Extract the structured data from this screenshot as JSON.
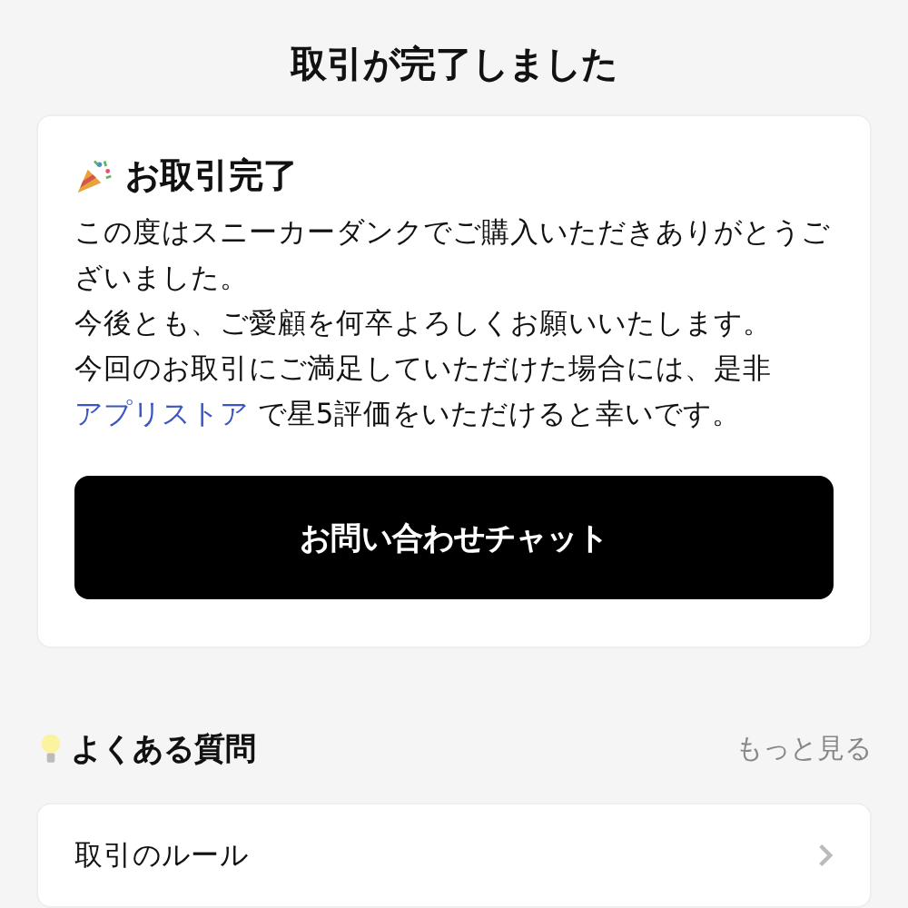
{
  "page_title": "取引が完了しました",
  "completion_card": {
    "heading": "お取引完了",
    "paragraphs": [
      "この度はスニーカーダンクでご購入いただきありがとうございました。",
      "今後とも、ご愛顧を何卒よろしくお願いいたします。"
    ],
    "closing": {
      "before": "今回のお取引にご満足していただけた場合には、是非",
      "link": "アプリストア",
      "after": " で星5評価をいただけると幸いです。"
    },
    "button": "お問い合わせチャット"
  },
  "faq": {
    "heading": "よくある質問",
    "more_link": "もっと見る",
    "items": [
      {
        "label": "取引のルール"
      }
    ]
  }
}
